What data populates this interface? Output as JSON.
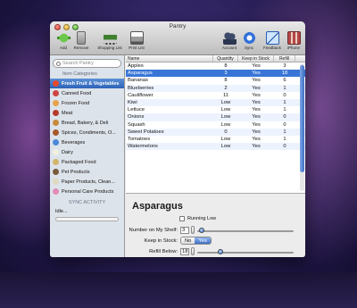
{
  "window": {
    "title": "Pantry"
  },
  "toolbar": {
    "add": "Add",
    "remove": "Remove",
    "shopping_list": "Shopping List",
    "print_list": "Print List",
    "account": "Account",
    "sync": "Sync",
    "feedback": "Feedback",
    "iphone": "iPhone"
  },
  "sidebar": {
    "search_placeholder": "Search Pantry",
    "header": "Item Categories",
    "categories": [
      {
        "label": "Fresh Fruit & Vegetables",
        "color": "#e44b2a"
      },
      {
        "label": "Canned Food",
        "color": "#c44"
      },
      {
        "label": "Frozen Food",
        "color": "#e6a24a"
      },
      {
        "label": "Meat",
        "color": "#b53b2b"
      },
      {
        "label": "Bread, Bakery, & Deli",
        "color": "#c98a3a"
      },
      {
        "label": "Spices, Condiments, O...",
        "color": "#a65a2a"
      },
      {
        "label": "Beverages",
        "color": "#4a8ad8"
      },
      {
        "label": "Dairy",
        "color": "#f0f0e0"
      },
      {
        "label": "Packaged Food",
        "color": "#d2b46a"
      },
      {
        "label": "Pet Products",
        "color": "#7a5a3a"
      },
      {
        "label": "Paper Products, Clean...",
        "color": "#e0d8c0"
      },
      {
        "label": "Personal Care Products",
        "color": "#e28ab8"
      }
    ],
    "sync_header": "SYNC ACTIVITY",
    "sync_status": "Idle..."
  },
  "table": {
    "columns": [
      "Name",
      "Quantity",
      "Keep in Stock",
      "Refill"
    ],
    "rows": [
      {
        "name": "Apples",
        "qty": "8",
        "keep": "Yes",
        "refill": "3"
      },
      {
        "name": "Asparagus",
        "qty": "3",
        "keep": "Yes",
        "refill": "18"
      },
      {
        "name": "Bananas",
        "qty": "8",
        "keep": "Yes",
        "refill": "6"
      },
      {
        "name": "Blueberries",
        "qty": "2",
        "keep": "Yes",
        "refill": "1"
      },
      {
        "name": "Cauliflower",
        "qty": "11",
        "keep": "Yes",
        "refill": "0"
      },
      {
        "name": "Kiwi",
        "qty": "Low",
        "keep": "Yes",
        "refill": "1"
      },
      {
        "name": "Lettuce",
        "qty": "Low",
        "keep": "Yes",
        "refill": "1"
      },
      {
        "name": "Onions",
        "qty": "Low",
        "keep": "Yes",
        "refill": "0"
      },
      {
        "name": "Squash",
        "qty": "Low",
        "keep": "Yes",
        "refill": "0"
      },
      {
        "name": "Sweet Potatoes",
        "qty": "0",
        "keep": "Yes",
        "refill": "1"
      },
      {
        "name": "Tomatoes",
        "qty": "Low",
        "keep": "Yes",
        "refill": "1"
      },
      {
        "name": "Watermelons",
        "qty": "Low",
        "keep": "Yes",
        "refill": "0"
      }
    ],
    "selected_index": 1
  },
  "detail": {
    "name": "Asparagus",
    "running_low_label": "Running Low",
    "shelf_label": "Number on My Shelf:",
    "shelf_value": "3",
    "keep_label": "Keep in Stock:",
    "keep_no": "No",
    "keep_yes": "Yes",
    "refill_label": "Refill Below:",
    "refill_value": "18"
  }
}
